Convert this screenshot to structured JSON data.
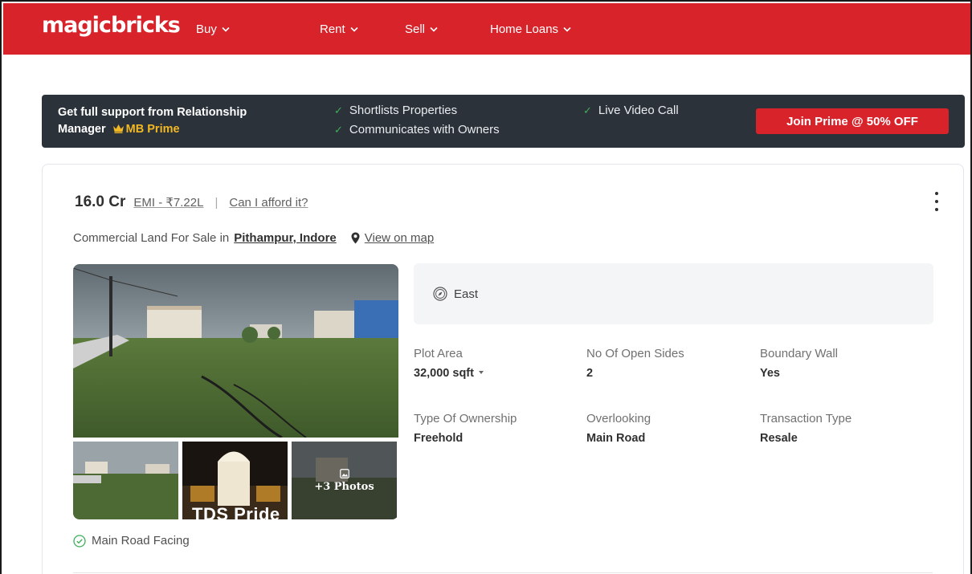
{
  "header": {
    "logo": "magicbricks",
    "nav": [
      {
        "label": "Buy"
      },
      {
        "label": "Rent"
      },
      {
        "label": "Sell"
      },
      {
        "label": "Home Loans"
      }
    ]
  },
  "prime_banner": {
    "title_line1": "Get full support from Relationship",
    "title_line2": "Manager",
    "brand": "MB Prime",
    "features": [
      "Shortlists Properties",
      "Communicates with Owners",
      "Live Video Call"
    ],
    "cta": "Join Prime @ 50% OFF"
  },
  "listing": {
    "currency_symbol": "",
    "price": "16.0 Cr",
    "emi": "EMI - ₹7.22L",
    "afford": "Can I afford it?",
    "separator": "|",
    "title_prefix": "Commercial Land For Sale in",
    "location": "Pithampur, Indore",
    "view_map": "View on map",
    "facing": "East",
    "more_photos": "+3 Photos",
    "thumb_caption": "TDS Pride",
    "highlight": "Main Road Facing",
    "specs": [
      {
        "label": "Plot Area",
        "value": "32,000 sqft"
      },
      {
        "label": "No Of Open Sides",
        "value": "2"
      },
      {
        "label": "Boundary Wall",
        "value": "Yes"
      },
      {
        "label": "Type Of Ownership",
        "value": "Freehold"
      },
      {
        "label": "Overlooking",
        "value": "Main Road"
      },
      {
        "label": "Transaction Type",
        "value": "Resale"
      }
    ]
  },
  "colors": {
    "brand_red": "#d8232a",
    "banner_bg": "#2b323a",
    "prime_gold": "#f2b824",
    "tick_green": "#3fae5a"
  }
}
